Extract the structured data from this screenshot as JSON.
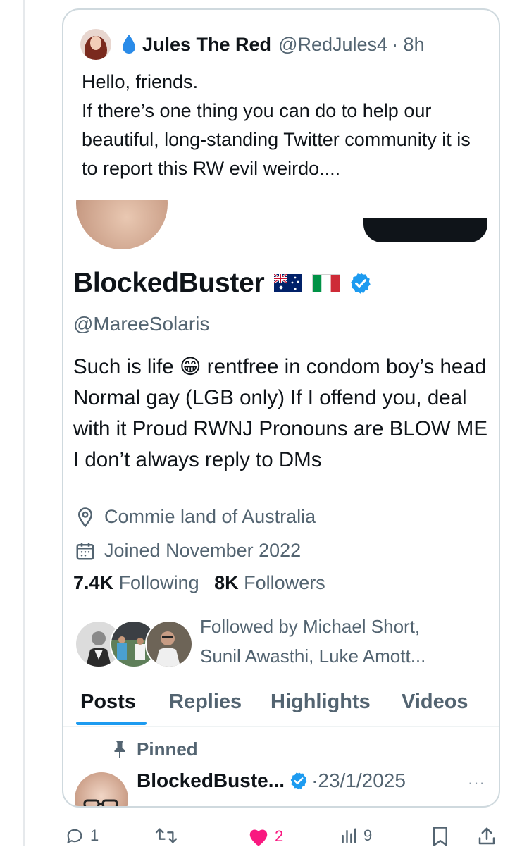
{
  "quoted_tweet": {
    "author_name": "Jules The Red",
    "author_handle": "@RedJules4",
    "time": "· 8h",
    "text": "Hello, friends.\nIf there’s one thing you can do to help our beautiful, long-standing Twitter community it is to report this RW evil weirdo...."
  },
  "profile": {
    "display_name": "BlockedBuster",
    "username": "@MareeSolaris",
    "bio": "Such is life 😁 rentfree in condom boy’s head Normal gay (LGB only) If I offend you, deal with it Proud RWNJ Pronouns are BLOW ME I don’t always reply to DMs",
    "location": "Commie land of Australia",
    "joined": "Joined November 2022",
    "following_count": "7.4K",
    "following_label": "Following",
    "followers_count": "8K",
    "followers_label": "Followers",
    "followed_by": "Followed by Michael Short,\nSunil Awasthi, Luke Amott..."
  },
  "tabs": [
    "Posts",
    "Replies",
    "Highlights",
    "Videos"
  ],
  "pinned_post": {
    "pinned_label": "Pinned",
    "author_name": "BlockedBuste...",
    "date": "·23/1/2025"
  },
  "actions": {
    "reply_count": "1",
    "like_count": "2",
    "view_count": "9"
  },
  "colors": {
    "accent": "#1d9bf0",
    "like": "#f91880",
    "secondary_text": "#536471",
    "card_border": "#cfd9de"
  }
}
